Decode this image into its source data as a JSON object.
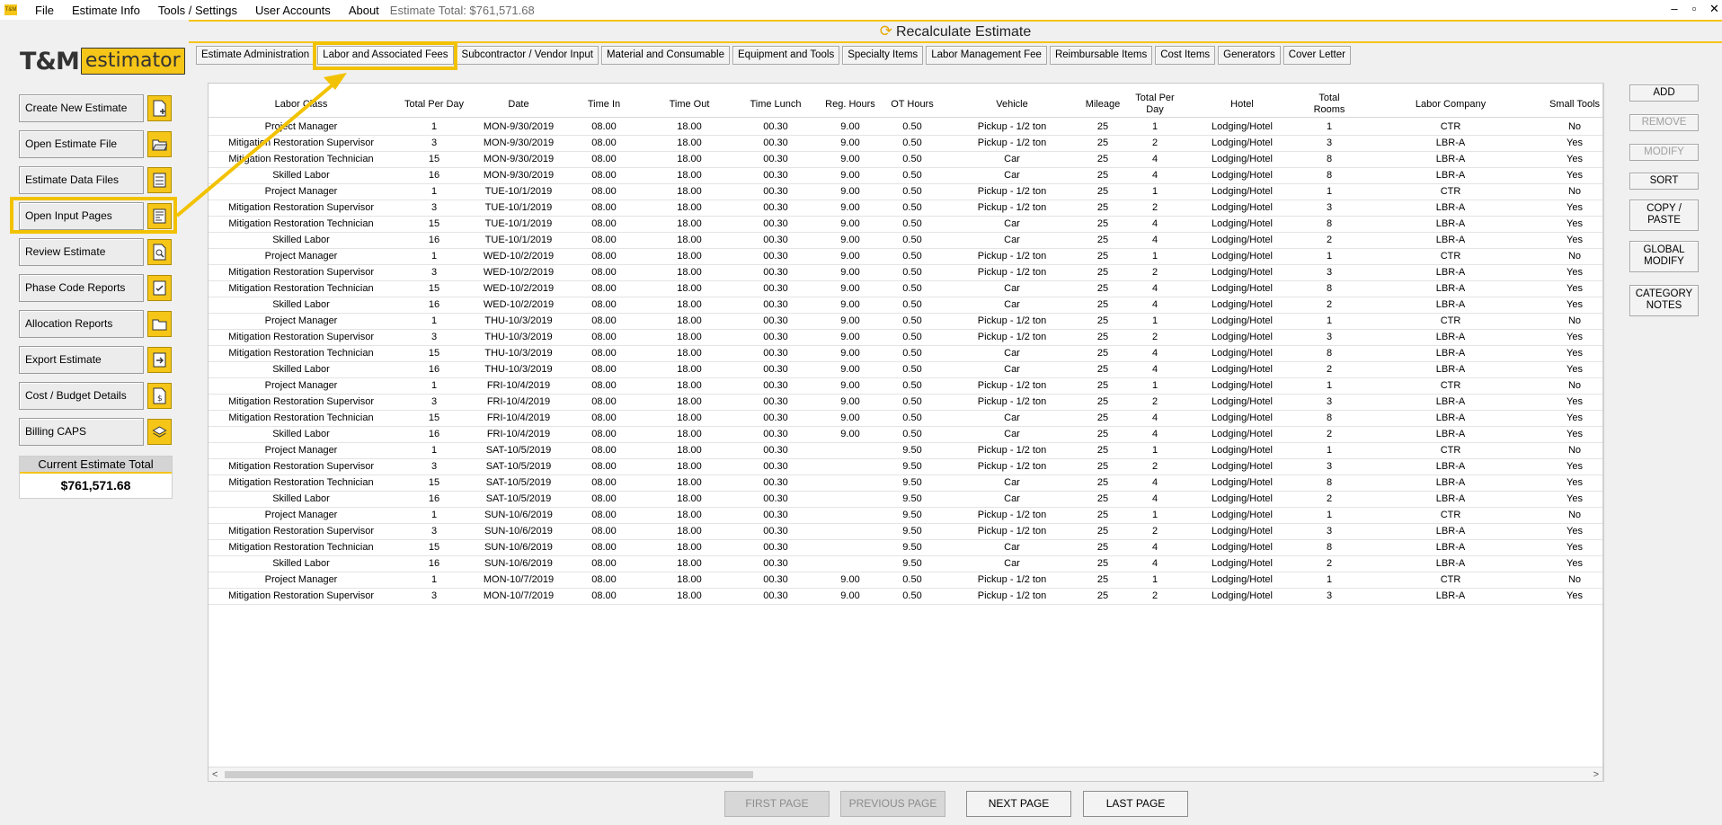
{
  "menu": {
    "items": [
      "File",
      "Estimate Info",
      "Tools / Settings",
      "User Accounts",
      "About"
    ],
    "estimate_total_label": "Estimate Total: $761,571.68",
    "app_icon_text": "T&M"
  },
  "logo": {
    "tm": "T&M",
    "estimator": "estimator"
  },
  "sidebar": {
    "buttons": [
      {
        "label": "Create New Estimate",
        "icon": "document-plus-icon"
      },
      {
        "label": "Open Estimate File",
        "icon": "folder-open-icon"
      },
      {
        "label": "Estimate Data Files",
        "icon": "list-icon"
      },
      {
        "label": "Open Input Pages",
        "icon": "form-icon"
      },
      {
        "label": "Review Estimate",
        "icon": "magnify-document-icon"
      },
      {
        "label": "Phase Code Reports",
        "icon": "checklist-icon"
      },
      {
        "label": "Allocation Reports",
        "icon": "folder-icon"
      },
      {
        "label": "Export Estimate",
        "icon": "export-icon"
      },
      {
        "label": "Cost / Budget Details",
        "icon": "dollar-document-icon"
      },
      {
        "label": "Billing CAPS",
        "icon": "layers-icon"
      }
    ],
    "current_total_label": "Current Estimate Total",
    "current_total_value": "$761,571.68"
  },
  "recalculate_label": "Recalculate Estimate",
  "tabs": [
    "Estimate Administration",
    "Labor and Associated Fees",
    "Subcontractor / Vendor Input",
    "Material and Consumable",
    "Equipment and Tools",
    "Specialty Items",
    "Labor Management Fee",
    "Reimbursable Items",
    "Cost Items",
    "Generators",
    "Cover Letter"
  ],
  "active_tab": "Labor and Associated Fees",
  "table": {
    "headers": [
      "Labor Class",
      "Total Per Day",
      "Date",
      "Time In",
      "Time Out",
      "Time Lunch",
      "Reg. Hours",
      "OT Hours",
      "Vehicle",
      "Mileage",
      "Total Per Day",
      "Hotel",
      "Total Rooms",
      "Labor Company",
      "Small Tools"
    ],
    "rows": [
      [
        "Project Manager",
        "1",
        "MON-9/30/2019",
        "08.00",
        "18.00",
        "00.30",
        "9.00",
        "0.50",
        "Pickup - 1/2 ton",
        "25",
        "1",
        "Lodging/Hotel",
        "1",
        "CTR",
        "No"
      ],
      [
        "Mitigation Restoration Supervisor",
        "3",
        "MON-9/30/2019",
        "08.00",
        "18.00",
        "00.30",
        "9.00",
        "0.50",
        "Pickup - 1/2 ton",
        "25",
        "2",
        "Lodging/Hotel",
        "3",
        "LBR-A",
        "Yes"
      ],
      [
        "Mitigation Restoration Technician",
        "15",
        "MON-9/30/2019",
        "08.00",
        "18.00",
        "00.30",
        "9.00",
        "0.50",
        "Car",
        "25",
        "4",
        "Lodging/Hotel",
        "8",
        "LBR-A",
        "Yes"
      ],
      [
        "Skilled Labor",
        "16",
        "MON-9/30/2019",
        "08.00",
        "18.00",
        "00.30",
        "9.00",
        "0.50",
        "Car",
        "25",
        "4",
        "Lodging/Hotel",
        "8",
        "LBR-A",
        "Yes"
      ],
      [
        "Project Manager",
        "1",
        "TUE-10/1/2019",
        "08.00",
        "18.00",
        "00.30",
        "9.00",
        "0.50",
        "Pickup - 1/2 ton",
        "25",
        "1",
        "Lodging/Hotel",
        "1",
        "CTR",
        "No"
      ],
      [
        "Mitigation Restoration Supervisor",
        "3",
        "TUE-10/1/2019",
        "08.00",
        "18.00",
        "00.30",
        "9.00",
        "0.50",
        "Pickup - 1/2 ton",
        "25",
        "2",
        "Lodging/Hotel",
        "3",
        "LBR-A",
        "Yes"
      ],
      [
        "Mitigation Restoration Technician",
        "15",
        "TUE-10/1/2019",
        "08.00",
        "18.00",
        "00.30",
        "9.00",
        "0.50",
        "Car",
        "25",
        "4",
        "Lodging/Hotel",
        "8",
        "LBR-A",
        "Yes"
      ],
      [
        "Skilled Labor",
        "16",
        "TUE-10/1/2019",
        "08.00",
        "18.00",
        "00.30",
        "9.00",
        "0.50",
        "Car",
        "25",
        "4",
        "Lodging/Hotel",
        "2",
        "LBR-A",
        "Yes"
      ],
      [
        "Project Manager",
        "1",
        "WED-10/2/2019",
        "08.00",
        "18.00",
        "00.30",
        "9.00",
        "0.50",
        "Pickup - 1/2 ton",
        "25",
        "1",
        "Lodging/Hotel",
        "1",
        "CTR",
        "No"
      ],
      [
        "Mitigation Restoration Supervisor",
        "3",
        "WED-10/2/2019",
        "08.00",
        "18.00",
        "00.30",
        "9.00",
        "0.50",
        "Pickup - 1/2 ton",
        "25",
        "2",
        "Lodging/Hotel",
        "3",
        "LBR-A",
        "Yes"
      ],
      [
        "Mitigation Restoration Technician",
        "15",
        "WED-10/2/2019",
        "08.00",
        "18.00",
        "00.30",
        "9.00",
        "0.50",
        "Car",
        "25",
        "4",
        "Lodging/Hotel",
        "8",
        "LBR-A",
        "Yes"
      ],
      [
        "Skilled Labor",
        "16",
        "WED-10/2/2019",
        "08.00",
        "18.00",
        "00.30",
        "9.00",
        "0.50",
        "Car",
        "25",
        "4",
        "Lodging/Hotel",
        "2",
        "LBR-A",
        "Yes"
      ],
      [
        "Project Manager",
        "1",
        "THU-10/3/2019",
        "08.00",
        "18.00",
        "00.30",
        "9.00",
        "0.50",
        "Pickup - 1/2 ton",
        "25",
        "1",
        "Lodging/Hotel",
        "1",
        "CTR",
        "No"
      ],
      [
        "Mitigation Restoration Supervisor",
        "3",
        "THU-10/3/2019",
        "08.00",
        "18.00",
        "00.30",
        "9.00",
        "0.50",
        "Pickup - 1/2 ton",
        "25",
        "2",
        "Lodging/Hotel",
        "3",
        "LBR-A",
        "Yes"
      ],
      [
        "Mitigation Restoration Technician",
        "15",
        "THU-10/3/2019",
        "08.00",
        "18.00",
        "00.30",
        "9.00",
        "0.50",
        "Car",
        "25",
        "4",
        "Lodging/Hotel",
        "8",
        "LBR-A",
        "Yes"
      ],
      [
        "Skilled Labor",
        "16",
        "THU-10/3/2019",
        "08.00",
        "18.00",
        "00.30",
        "9.00",
        "0.50",
        "Car",
        "25",
        "4",
        "Lodging/Hotel",
        "2",
        "LBR-A",
        "Yes"
      ],
      [
        "Project Manager",
        "1",
        "FRI-10/4/2019",
        "08.00",
        "18.00",
        "00.30",
        "9.00",
        "0.50",
        "Pickup - 1/2 ton",
        "25",
        "1",
        "Lodging/Hotel",
        "1",
        "CTR",
        "No"
      ],
      [
        "Mitigation Restoration Supervisor",
        "3",
        "FRI-10/4/2019",
        "08.00",
        "18.00",
        "00.30",
        "9.00",
        "0.50",
        "Pickup - 1/2 ton",
        "25",
        "2",
        "Lodging/Hotel",
        "3",
        "LBR-A",
        "Yes"
      ],
      [
        "Mitigation Restoration Technician",
        "15",
        "FRI-10/4/2019",
        "08.00",
        "18.00",
        "00.30",
        "9.00",
        "0.50",
        "Car",
        "25",
        "4",
        "Lodging/Hotel",
        "8",
        "LBR-A",
        "Yes"
      ],
      [
        "Skilled Labor",
        "16",
        "FRI-10/4/2019",
        "08.00",
        "18.00",
        "00.30",
        "9.00",
        "0.50",
        "Car",
        "25",
        "4",
        "Lodging/Hotel",
        "2",
        "LBR-A",
        "Yes"
      ],
      [
        "Project Manager",
        "1",
        "SAT-10/5/2019",
        "08.00",
        "18.00",
        "00.30",
        "",
        "9.50",
        "Pickup - 1/2 ton",
        "25",
        "1",
        "Lodging/Hotel",
        "1",
        "CTR",
        "No"
      ],
      [
        "Mitigation Restoration Supervisor",
        "3",
        "SAT-10/5/2019",
        "08.00",
        "18.00",
        "00.30",
        "",
        "9.50",
        "Pickup - 1/2 ton",
        "25",
        "2",
        "Lodging/Hotel",
        "3",
        "LBR-A",
        "Yes"
      ],
      [
        "Mitigation Restoration Technician",
        "15",
        "SAT-10/5/2019",
        "08.00",
        "18.00",
        "00.30",
        "",
        "9.50",
        "Car",
        "25",
        "4",
        "Lodging/Hotel",
        "8",
        "LBR-A",
        "Yes"
      ],
      [
        "Skilled Labor",
        "16",
        "SAT-10/5/2019",
        "08.00",
        "18.00",
        "00.30",
        "",
        "9.50",
        "Car",
        "25",
        "4",
        "Lodging/Hotel",
        "2",
        "LBR-A",
        "Yes"
      ],
      [
        "Project Manager",
        "1",
        "SUN-10/6/2019",
        "08.00",
        "18.00",
        "00.30",
        "",
        "9.50",
        "Pickup - 1/2 ton",
        "25",
        "1",
        "Lodging/Hotel",
        "1",
        "CTR",
        "No"
      ],
      [
        "Mitigation Restoration Supervisor",
        "3",
        "SUN-10/6/2019",
        "08.00",
        "18.00",
        "00.30",
        "",
        "9.50",
        "Pickup - 1/2 ton",
        "25",
        "2",
        "Lodging/Hotel",
        "3",
        "LBR-A",
        "Yes"
      ],
      [
        "Mitigation Restoration Technician",
        "15",
        "SUN-10/6/2019",
        "08.00",
        "18.00",
        "00.30",
        "",
        "9.50",
        "Car",
        "25",
        "4",
        "Lodging/Hotel",
        "8",
        "LBR-A",
        "Yes"
      ],
      [
        "Skilled Labor",
        "16",
        "SUN-10/6/2019",
        "08.00",
        "18.00",
        "00.30",
        "",
        "9.50",
        "Car",
        "25",
        "4",
        "Lodging/Hotel",
        "2",
        "LBR-A",
        "Yes"
      ],
      [
        "Project Manager",
        "1",
        "MON-10/7/2019",
        "08.00",
        "18.00",
        "00.30",
        "9.00",
        "0.50",
        "Pickup - 1/2 ton",
        "25",
        "1",
        "Lodging/Hotel",
        "1",
        "CTR",
        "No"
      ],
      [
        "Mitigation Restoration Supervisor",
        "3",
        "MON-10/7/2019",
        "08.00",
        "18.00",
        "00.30",
        "9.00",
        "0.50",
        "Pickup - 1/2 ton",
        "25",
        "2",
        "Lodging/Hotel",
        "3",
        "LBR-A",
        "Yes"
      ]
    ]
  },
  "right_buttons": [
    {
      "label": "ADD",
      "enabled": true
    },
    {
      "label": "REMOVE",
      "enabled": false
    },
    {
      "label": "MODIFY",
      "enabled": false
    },
    {
      "label": "SORT",
      "enabled": true
    },
    {
      "label": "COPY /\nPASTE",
      "enabled": true
    },
    {
      "label": "GLOBAL\nMODIFY",
      "enabled": true
    },
    {
      "label": "CATEGORY\nNOTES",
      "enabled": true
    }
  ],
  "pagination": {
    "first": "FIRST PAGE",
    "previous": "PREVIOUS PAGE",
    "next": "NEXT PAGE",
    "last": "LAST PAGE"
  },
  "colors": {
    "accent": "#f5c518",
    "highlight": "#f2c200"
  }
}
